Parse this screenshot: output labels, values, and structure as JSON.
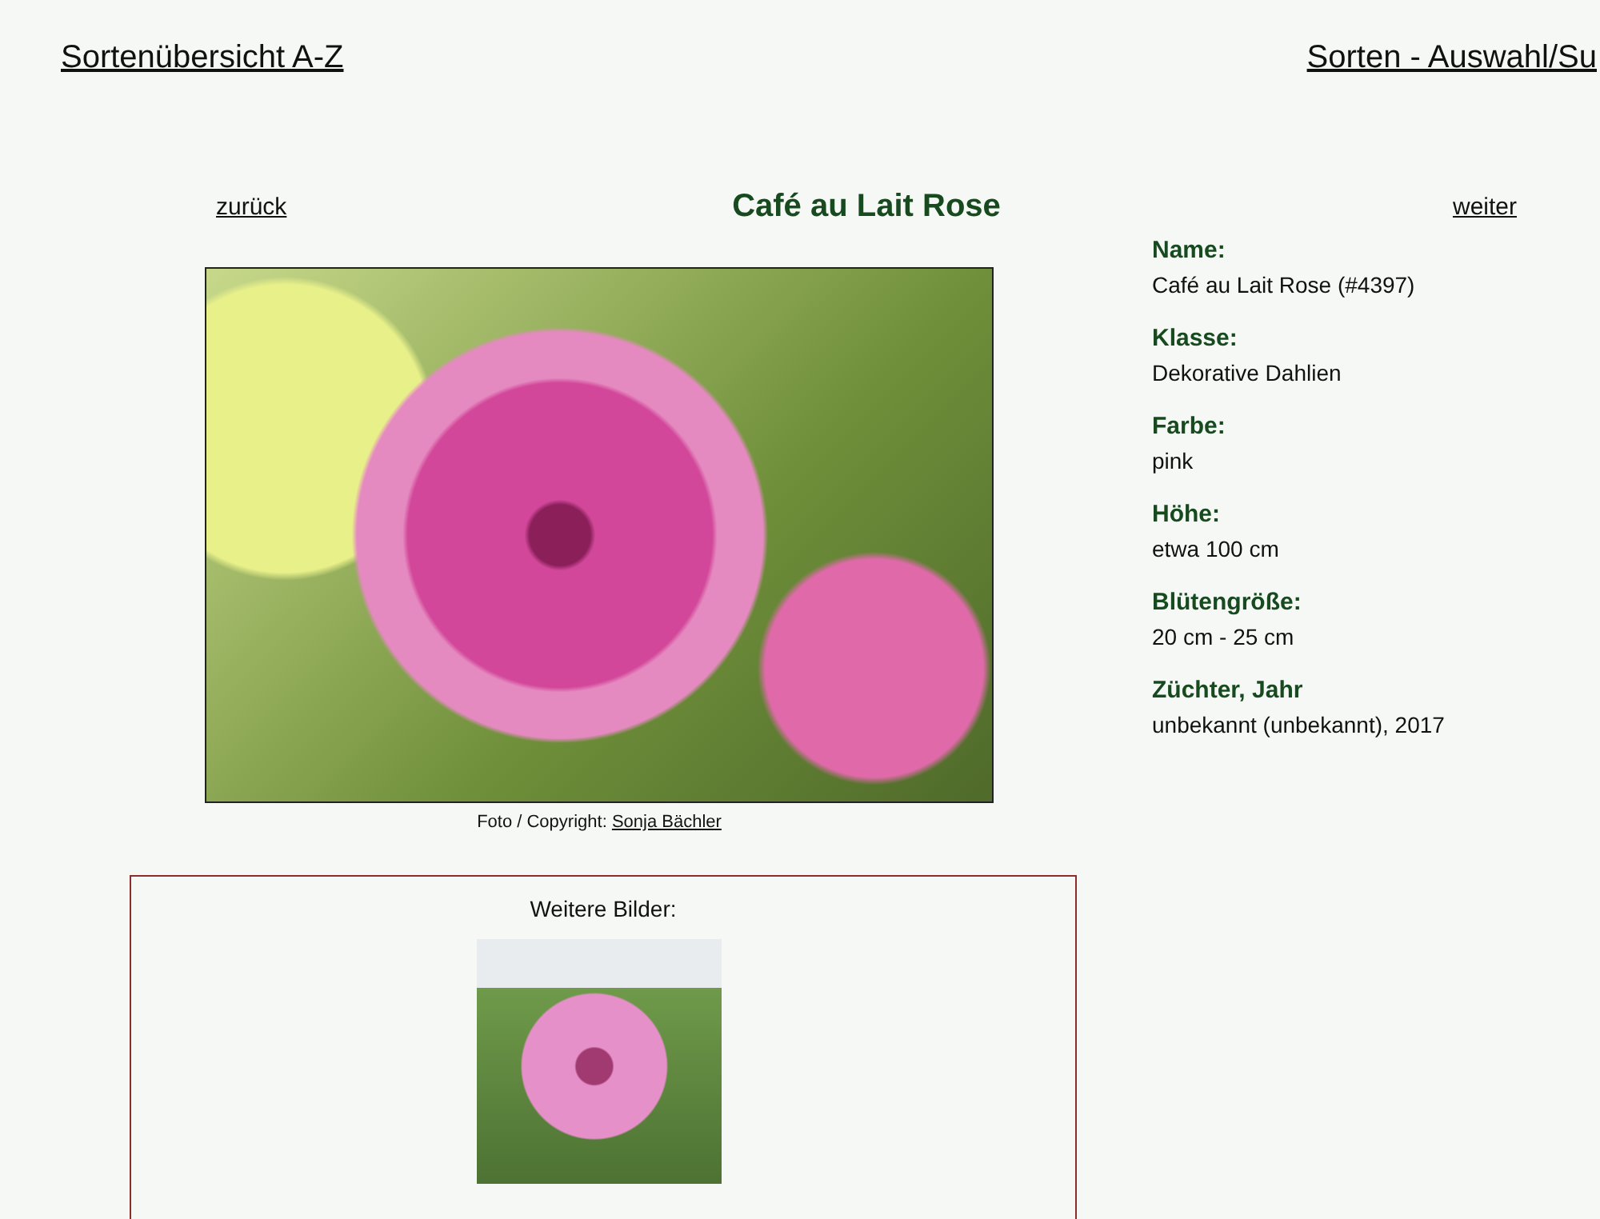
{
  "site_nav": [
    {
      "label": "Sortenübersicht A-Z"
    },
    {
      "label": "Sorten - Auswahl/Su"
    }
  ],
  "variety_nav": {
    "previous": "zurück",
    "title": "Café au Lait Rose",
    "next": "weiter"
  },
  "photo": {
    "credit_prefix": "Foto / Copyright:",
    "credit_author": "Sonja Bächler"
  },
  "details": [
    {
      "label": "Name:",
      "value": "Café au Lait Rose (#4397)"
    },
    {
      "label": "Klasse:",
      "value": "Dekorative Dahlien"
    },
    {
      "label": "Farbe:",
      "value": "pink"
    },
    {
      "label": "Höhe:",
      "value": "etwa 100 cm"
    },
    {
      "label": "Blütengröße:",
      "value": "20 cm - 25 cm"
    },
    {
      "label": "Züchter, Jahr",
      "value": "unbekannt (unbekannt), 2017"
    }
  ],
  "more_images": {
    "heading": "Weitere Bilder:",
    "thumbnails": [
      {
        "kind": "photo"
      }
    ]
  }
}
